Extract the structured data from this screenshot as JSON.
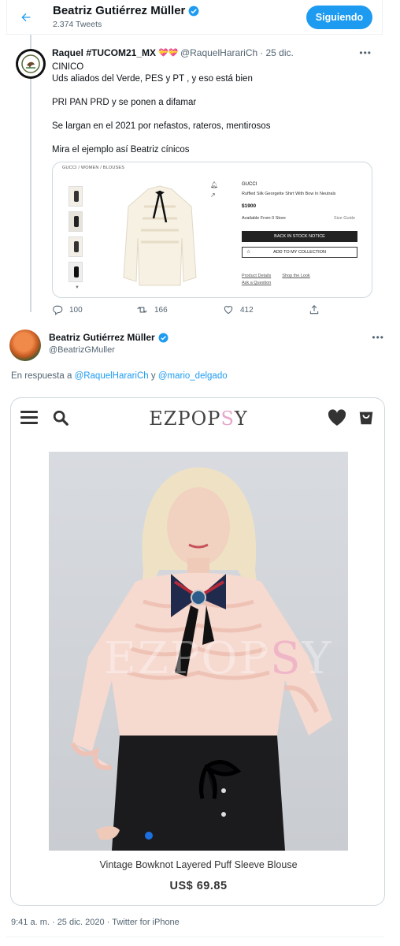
{
  "header": {
    "name": "Beatriz Gutiérrez Müller",
    "tweet_count": "2.374 Tweets",
    "follow_label": "Siguiendo"
  },
  "tweet1": {
    "name": "Raquel #TUCOM21_MX",
    "flag_emojis": "💝💝",
    "handle": "@RaquelHarariCh",
    "date": "· 25 dic.",
    "lines": [
      "CINICO",
      "Uds aliados del Verde, PES y PT , y eso está bien",
      "PRI PAN PRD  y se ponen a difamar",
      "Se largan en el 2021 por nefastos, rateros,  mentirosos",
      "Mira el ejemplo así Beatriz cínicos"
    ],
    "media": {
      "breadcrumb": "GUCCI / WOMEN / BLOUSES",
      "brand": "GUCCI",
      "product_name": "Ruffled Silk Georgette Shirt With Bow In Neutrals",
      "price": "$1900",
      "availability": "Available From 0 Store",
      "size_guide": "Size Guide",
      "stock_button": "BACK IN STOCK NOTICE",
      "collection_button": "ADD TO MY COLLECTION",
      "link_details": "Product Details",
      "link_look": "Shop the Look",
      "link_question": "Ask a Question"
    },
    "actions": {
      "replies": "100",
      "retweets": "166",
      "likes": "412"
    }
  },
  "tweet2": {
    "name": "Beatriz Gutiérrez Müller",
    "handle": "@BeatrizGMuller",
    "reply_prefix": "En respuesta a",
    "reply_user1": "@RaquelHarariCh",
    "reply_and": "y",
    "reply_user2": "@mario_delgado",
    "media": {
      "logo_part1": "EZPOP",
      "logo_part2": "S",
      "logo_part3": "Y",
      "watermark_part1": "EZPOP",
      "watermark_part2": "S",
      "watermark_part3": "Y",
      "product_title": "Vintage Bowknot Layered Puff Sleeve Blouse",
      "product_price": "US$ 69.85"
    },
    "meta": "9:41 a. m. · 25 dic. 2020 · Twitter for iPhone"
  },
  "colors": {
    "accent": "#1d9bf0",
    "text": "#0f1419",
    "muted": "#536471"
  },
  "icons": [
    "back-arrow-icon",
    "verified-icon",
    "more-icon",
    "reply-icon",
    "retweet-icon",
    "like-icon",
    "share-icon",
    "menu-icon",
    "search-icon",
    "heart-icon",
    "bag-icon",
    "bell-icon",
    "share-small-icon",
    "star-icon"
  ]
}
